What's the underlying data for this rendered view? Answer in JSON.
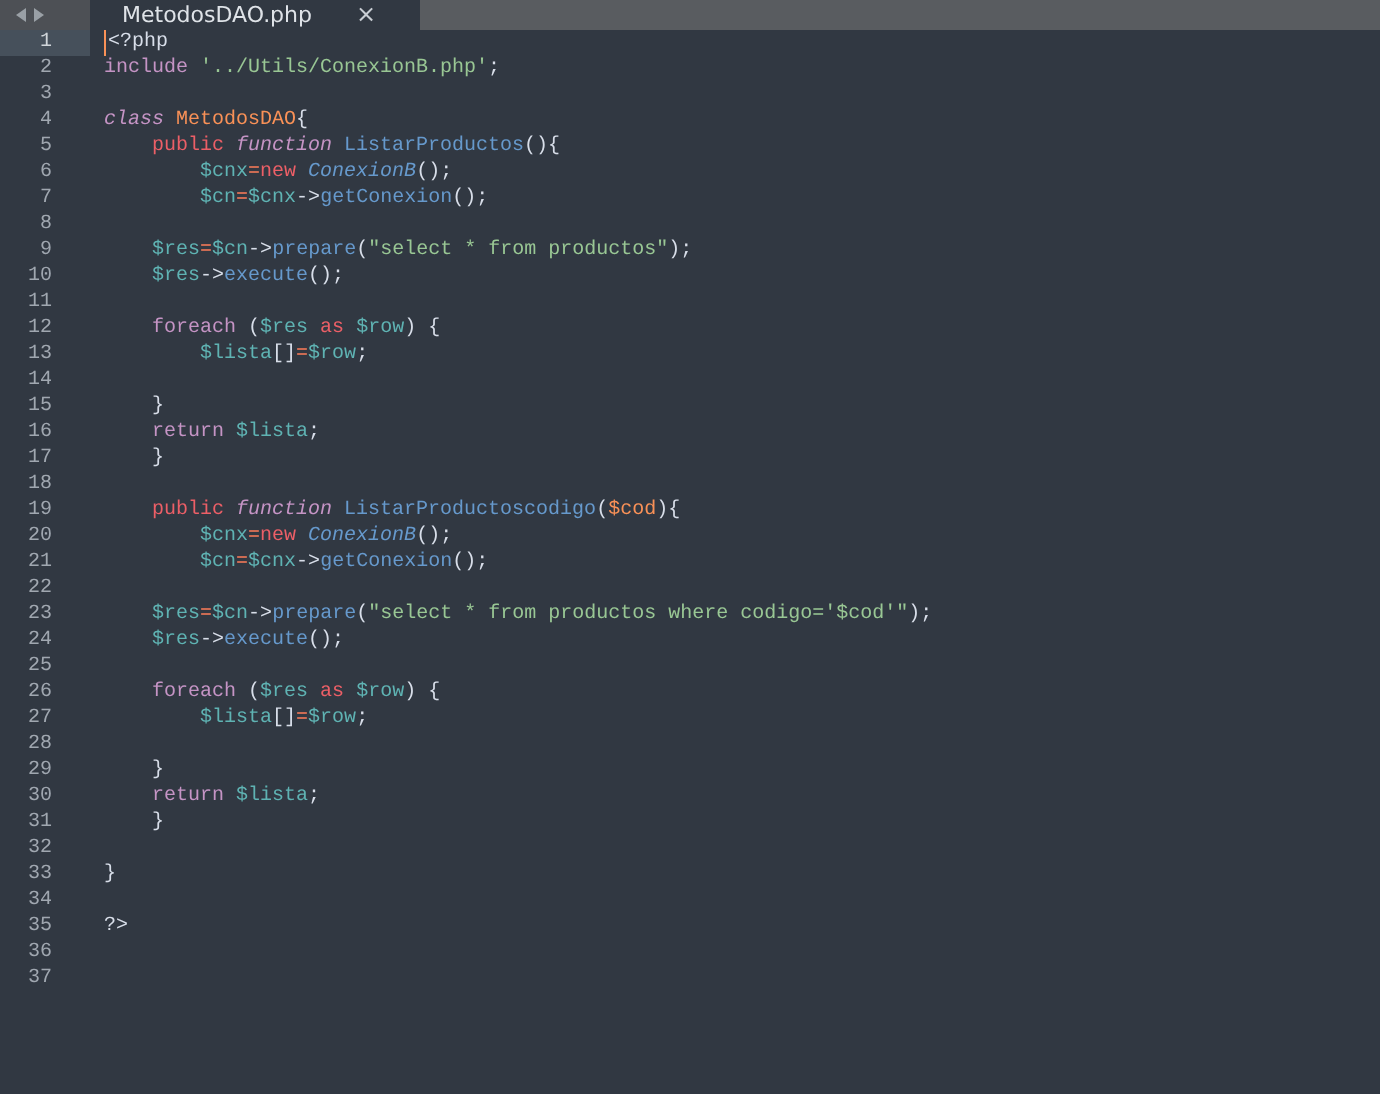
{
  "tab_bar": {
    "tabs": [
      {
        "label": "MetodosDAO.php",
        "close": "×",
        "selected": true
      }
    ]
  },
  "editor": {
    "lines": [
      {
        "number": "1",
        "current": true,
        "tokens": [
          {
            "kind": "plain",
            "text": "<?php"
          }
        ]
      },
      {
        "number": "2",
        "current": false,
        "tokens": [
          {
            "kind": "keyword",
            "text": "include "
          },
          {
            "kind": "string",
            "text": "'../Utils/ConexionB.php'"
          },
          {
            "kind": "plain",
            "text": ";"
          }
        ]
      },
      {
        "number": "3",
        "current": false
      },
      {
        "number": "4",
        "current": false,
        "tokens": [
          {
            "kind": "keyword_italic",
            "text": "class "
          },
          {
            "kind": "class_name",
            "text": "MetodosDAO"
          },
          {
            "kind": "plain",
            "text": "{"
          }
        ]
      },
      {
        "number": "5",
        "current": false,
        "tokens": [
          {
            "kind": "storage",
            "text": "    public "
          },
          {
            "kind": "keyword_italic",
            "text": "function "
          },
          {
            "kind": "entity",
            "text": "ListarProductos"
          },
          {
            "kind": "plain",
            "text": "(){"
          }
        ]
      },
      {
        "number": "6",
        "current": false,
        "tokens": [
          {
            "kind": "variable",
            "text": "        $cnx"
          },
          {
            "kind": "operator",
            "text": "="
          },
          {
            "kind": "storage",
            "text": "new "
          },
          {
            "kind": "entity_italic",
            "text": "ConexionB"
          },
          {
            "kind": "plain",
            "text": "();"
          }
        ]
      },
      {
        "number": "7",
        "current": false,
        "tokens": [
          {
            "kind": "variable",
            "text": "        $cn"
          },
          {
            "kind": "operator",
            "text": "="
          },
          {
            "kind": "variable",
            "text": "$cnx"
          },
          {
            "kind": "plain",
            "text": "->"
          },
          {
            "kind": "entity",
            "text": "getConexion"
          },
          {
            "kind": "plain",
            "text": "();"
          }
        ]
      },
      {
        "number": "8",
        "current": false
      },
      {
        "number": "9",
        "current": false,
        "tokens": [
          {
            "kind": "variable",
            "text": "    $res"
          },
          {
            "kind": "operator",
            "text": "="
          },
          {
            "kind": "variable",
            "text": "$cn"
          },
          {
            "kind": "plain",
            "text": "->"
          },
          {
            "kind": "entity",
            "text": "prepare"
          },
          {
            "kind": "plain",
            "text": "("
          },
          {
            "kind": "string",
            "text": "\"select * from productos\""
          },
          {
            "kind": "plain",
            "text": ");"
          }
        ]
      },
      {
        "number": "10",
        "current": false,
        "tokens": [
          {
            "kind": "variable",
            "text": "    $res"
          },
          {
            "kind": "plain",
            "text": "->"
          },
          {
            "kind": "entity",
            "text": "execute"
          },
          {
            "kind": "plain",
            "text": "();"
          }
        ]
      },
      {
        "number": "11",
        "current": false
      },
      {
        "number": "12",
        "current": false,
        "tokens": [
          {
            "kind": "keyword",
            "text": "    foreach"
          },
          {
            "kind": "plain",
            "text": " ("
          },
          {
            "kind": "variable",
            "text": "$res "
          },
          {
            "kind": "storage",
            "text": "as "
          },
          {
            "kind": "variable",
            "text": "$row"
          },
          {
            "kind": "plain",
            "text": ") {"
          }
        ]
      },
      {
        "number": "13",
        "current": false,
        "tokens": [
          {
            "kind": "variable",
            "text": "        $lista"
          },
          {
            "kind": "plain",
            "text": "[]"
          },
          {
            "kind": "operator",
            "text": "="
          },
          {
            "kind": "variable",
            "text": "$row"
          },
          {
            "kind": "plain",
            "text": ";"
          }
        ]
      },
      {
        "number": "14",
        "current": false
      },
      {
        "number": "15",
        "current": false,
        "tokens": [
          {
            "kind": "plain",
            "text": "    }"
          }
        ]
      },
      {
        "number": "16",
        "current": false,
        "tokens": [
          {
            "kind": "keyword",
            "text": "    return "
          },
          {
            "kind": "variable",
            "text": "$lista"
          },
          {
            "kind": "plain",
            "text": ";"
          }
        ]
      },
      {
        "number": "17",
        "current": false,
        "tokens": [
          {
            "kind": "plain",
            "text": "    }"
          }
        ]
      },
      {
        "number": "18",
        "current": false
      },
      {
        "number": "19",
        "current": false,
        "tokens": [
          {
            "kind": "storage",
            "text": "    public "
          },
          {
            "kind": "keyword_italic",
            "text": "function "
          },
          {
            "kind": "entity",
            "text": "ListarProductoscodigo"
          },
          {
            "kind": "plain",
            "text": "("
          },
          {
            "kind": "parameter",
            "text": "$cod"
          },
          {
            "kind": "plain",
            "text": "){"
          }
        ]
      },
      {
        "number": "20",
        "current": false,
        "tokens": [
          {
            "kind": "variable",
            "text": "        $cnx"
          },
          {
            "kind": "operator",
            "text": "="
          },
          {
            "kind": "storage",
            "text": "new "
          },
          {
            "kind": "entity_italic",
            "text": "ConexionB"
          },
          {
            "kind": "plain",
            "text": "();"
          }
        ]
      },
      {
        "number": "21",
        "current": false,
        "tokens": [
          {
            "kind": "variable",
            "text": "        $cn"
          },
          {
            "kind": "operator",
            "text": "="
          },
          {
            "kind": "variable",
            "text": "$cnx"
          },
          {
            "kind": "plain",
            "text": "->"
          },
          {
            "kind": "entity",
            "text": "getConexion"
          },
          {
            "kind": "plain",
            "text": "();"
          }
        ]
      },
      {
        "number": "22",
        "current": false
      },
      {
        "number": "23",
        "current": false,
        "tokens": [
          {
            "kind": "variable",
            "text": "    $res"
          },
          {
            "kind": "operator",
            "text": "="
          },
          {
            "kind": "variable",
            "text": "$cn"
          },
          {
            "kind": "plain",
            "text": "->"
          },
          {
            "kind": "entity",
            "text": "prepare"
          },
          {
            "kind": "plain",
            "text": "("
          },
          {
            "kind": "string",
            "text": "\"select * from productos where codigo='$cod'\""
          },
          {
            "kind": "plain",
            "text": ");"
          }
        ]
      },
      {
        "number": "24",
        "current": false,
        "tokens": [
          {
            "kind": "variable",
            "text": "    $res"
          },
          {
            "kind": "plain",
            "text": "->"
          },
          {
            "kind": "entity",
            "text": "execute"
          },
          {
            "kind": "plain",
            "text": "();"
          }
        ]
      },
      {
        "number": "25",
        "current": false
      },
      {
        "number": "26",
        "current": false,
        "tokens": [
          {
            "kind": "keyword",
            "text": "    foreach"
          },
          {
            "kind": "plain",
            "text": " ("
          },
          {
            "kind": "variable",
            "text": "$res "
          },
          {
            "kind": "storage",
            "text": "as "
          },
          {
            "kind": "variable",
            "text": "$row"
          },
          {
            "kind": "plain",
            "text": ") {"
          }
        ]
      },
      {
        "number": "27",
        "current": false,
        "tokens": [
          {
            "kind": "variable",
            "text": "        $lista"
          },
          {
            "kind": "plain",
            "text": "[]"
          },
          {
            "kind": "operator",
            "text": "="
          },
          {
            "kind": "variable",
            "text": "$row"
          },
          {
            "kind": "plain",
            "text": ";"
          }
        ]
      },
      {
        "number": "28",
        "current": false
      },
      {
        "number": "29",
        "current": false,
        "tokens": [
          {
            "kind": "plain",
            "text": "    }"
          }
        ]
      },
      {
        "number": "30",
        "current": false,
        "tokens": [
          {
            "kind": "keyword",
            "text": "    return "
          },
          {
            "kind": "variable",
            "text": "$lista"
          },
          {
            "kind": "plain",
            "text": ";"
          }
        ]
      },
      {
        "number": "31",
        "current": false,
        "tokens": [
          {
            "kind": "plain",
            "text": "    }"
          }
        ]
      },
      {
        "number": "32",
        "current": false
      },
      {
        "number": "33",
        "current": false,
        "tokens": [
          {
            "kind": "plain",
            "text": "}"
          }
        ]
      },
      {
        "number": "34",
        "current": false
      },
      {
        "number": "35",
        "current": false,
        "tokens": [
          {
            "kind": "plain",
            "text": "?>"
          }
        ]
      },
      {
        "number": "36",
        "current": false
      },
      {
        "number": "37",
        "current": false
      }
    ]
  }
}
